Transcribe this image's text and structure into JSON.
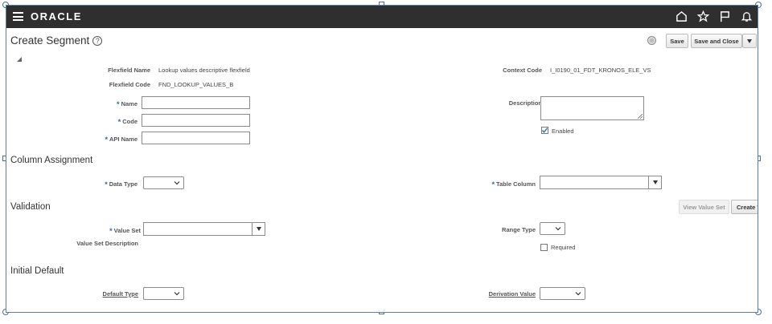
{
  "topbar": {
    "logo": "ORACLE"
  },
  "page": {
    "title": "Create Segment",
    "help": "?"
  },
  "buttons": {
    "save": "Save",
    "save_close": "Save and Close",
    "view_value_set": "View Value Set",
    "create_value_set": "Create V"
  },
  "header_fields": {
    "flexfield_name_label": "Flexfield Name",
    "flexfield_name_value": "Lookup values descriptive flexfield",
    "flexfield_code_label": "Flexfield Code",
    "flexfield_code_value": "FND_LOOKUP_VALUES_B",
    "context_code_label": "Context Code",
    "context_code_value": "I_I0190_01_FDT_KRONOS_ELE_VS"
  },
  "form": {
    "name_label": "Name",
    "code_label": "Code",
    "api_name_label": "API Name",
    "description_label": "Description",
    "enabled_label": "Enabled",
    "enabled_checked": true
  },
  "sections": {
    "column_assignment": "Column Assignment",
    "validation": "Validation",
    "initial_default": "Initial Default"
  },
  "column_assignment": {
    "data_type_label": "Data Type",
    "table_column_label": "Table Column"
  },
  "validation": {
    "value_set_label": "Value Set",
    "value_set_description_label": "Value Set Description",
    "range_type_label": "Range Type",
    "required_label": "Required"
  },
  "initial_default": {
    "default_type_label": "Default Type",
    "derivation_value_label": "Derivation Value"
  },
  "required_marker": "*"
}
